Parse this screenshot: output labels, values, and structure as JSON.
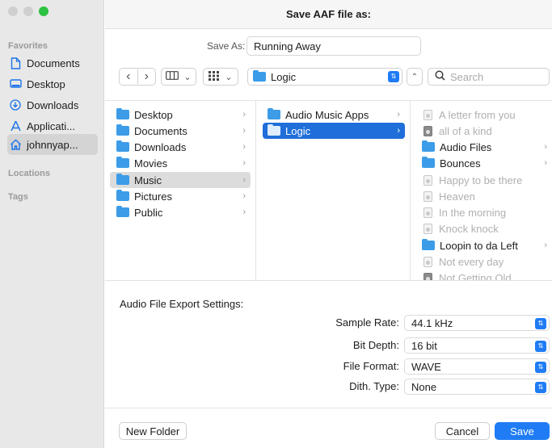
{
  "window": {
    "title": "Save AAF file as:"
  },
  "colors": {
    "accent": "#1f7cf5",
    "selection_blue": "#1f6ed9",
    "folder": "#3c9ce8",
    "zoom": "#2dc241"
  },
  "sidebar": {
    "favorites_label": "Favorites",
    "locations_label": "Locations",
    "tags_label": "Tags",
    "items": [
      {
        "label": "Documents",
        "icon": "document-icon"
      },
      {
        "label": "Desktop",
        "icon": "desktop-icon"
      },
      {
        "label": "Downloads",
        "icon": "download-icon"
      },
      {
        "label": "Applicati...",
        "icon": "applications-icon"
      },
      {
        "label": "johnnyap...",
        "icon": "home-icon",
        "selected": true
      }
    ]
  },
  "save_as": {
    "label": "Save As:",
    "value": "Running Away"
  },
  "toolbar": {
    "back": "‹",
    "forward": "›",
    "location": "Logic",
    "search_placeholder": "Search"
  },
  "browser": {
    "col1": [
      {
        "label": "Desktop"
      },
      {
        "label": "Documents"
      },
      {
        "label": "Downloads"
      },
      {
        "label": "Movies"
      },
      {
        "label": "Music",
        "selected": true
      },
      {
        "label": "Pictures"
      },
      {
        "label": "Public"
      }
    ],
    "col2": [
      {
        "label": "Audio Music Apps"
      },
      {
        "label": "Logic",
        "selected": true
      }
    ],
    "col3": [
      {
        "label": "A letter from you",
        "kind": "doc",
        "dim": true
      },
      {
        "label": "all of a kind",
        "kind": "doc-solid",
        "dim": true
      },
      {
        "label": "Audio Files",
        "kind": "folder"
      },
      {
        "label": "Bounces",
        "kind": "folder"
      },
      {
        "label": "Happy to be there",
        "kind": "doc",
        "dim": true
      },
      {
        "label": "Heaven",
        "kind": "doc",
        "dim": true
      },
      {
        "label": "In the morning",
        "kind": "doc",
        "dim": true
      },
      {
        "label": "Knock knock",
        "kind": "doc",
        "dim": true
      },
      {
        "label": "Loopin to da Left",
        "kind": "folder"
      },
      {
        "label": "Not every day",
        "kind": "doc",
        "dim": true
      },
      {
        "label": "Not Getting Old",
        "kind": "doc-solid",
        "dim": true
      }
    ]
  },
  "export": {
    "title": "Audio File Export Settings:",
    "sample_rate": {
      "label": "Sample Rate:",
      "value": "44.1 kHz"
    },
    "bit_depth": {
      "label": "Bit Depth:",
      "value": "16 bit"
    },
    "file_format": {
      "label": "File Format:",
      "value": "WAVE"
    },
    "dith_type": {
      "label": "Dith. Type:",
      "value": "None"
    }
  },
  "buttons": {
    "new_folder": "New Folder",
    "cancel": "Cancel",
    "save": "Save"
  }
}
